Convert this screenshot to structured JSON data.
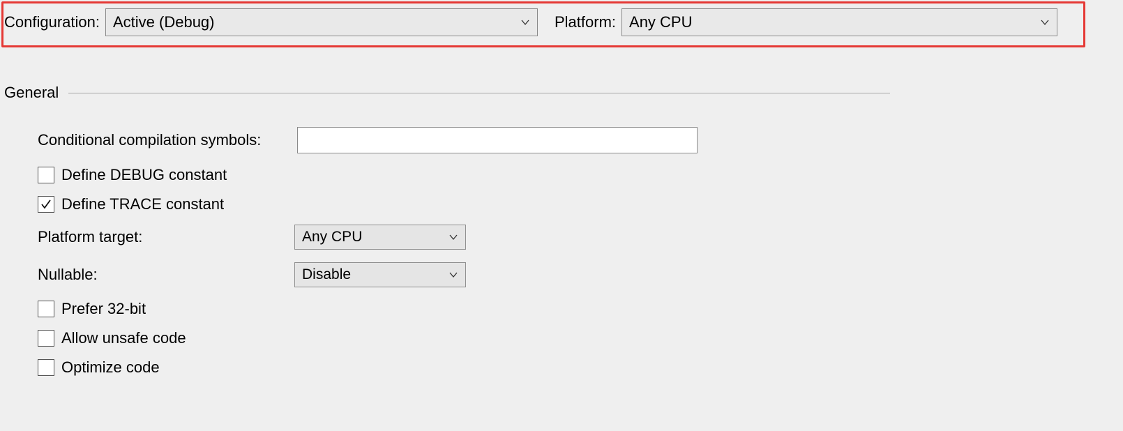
{
  "topbar": {
    "configuration_label": "Configuration:",
    "configuration_value": "Active (Debug)",
    "platform_label": "Platform:",
    "platform_value": "Any CPU"
  },
  "section": {
    "title": "General"
  },
  "form": {
    "cond_symbols": {
      "label": "Conditional compilation symbols:",
      "value": ""
    },
    "define_debug": {
      "label": "Define DEBUG constant",
      "checked": false
    },
    "define_trace": {
      "label": "Define TRACE constant",
      "checked": true
    },
    "platform_target": {
      "label": "Platform target:",
      "value": "Any CPU"
    },
    "nullable": {
      "label": "Nullable:",
      "value": "Disable"
    },
    "prefer_32bit": {
      "label": "Prefer 32-bit",
      "checked": false
    },
    "allow_unsafe": {
      "label": "Allow unsafe code",
      "checked": false
    },
    "optimize_code": {
      "label": "Optimize code",
      "checked": false
    }
  }
}
